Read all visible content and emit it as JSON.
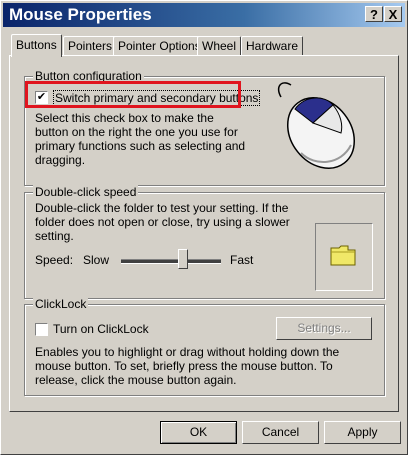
{
  "window": {
    "title": "Mouse Properties",
    "help_button": "?",
    "close_button": "X"
  },
  "tabs": [
    {
      "label": "Buttons",
      "active": true
    },
    {
      "label": "Pointers",
      "active": false
    },
    {
      "label": "Pointer Options",
      "active": false
    },
    {
      "label": "Wheel",
      "active": false
    },
    {
      "label": "Hardware",
      "active": false
    }
  ],
  "button_configuration": {
    "label": "Button configuration",
    "checkbox_label": "Switch primary and secondary buttons",
    "checked": true,
    "description": "Select this check box to make the button on the right the one you use for primary functions such as selecting and dragging.",
    "highlight_color": "#e0141e",
    "image": "mouse-icon"
  },
  "double_click_speed": {
    "label": "Double-click speed",
    "description": "Double-click the folder to test your setting. If the folder does not open or close, try using a slower setting.",
    "speed_label": "Speed:",
    "slow_label": "Slow",
    "fast_label": "Fast",
    "slider_value_fraction": 0.62,
    "test_area_icon": "folder-icon"
  },
  "clicklock": {
    "label": "ClickLock",
    "checkbox_label": "Turn on ClickLock",
    "checked": false,
    "settings_button": "Settings...",
    "description": "Enables you to highlight or drag without holding down the mouse button. To set, briefly press the mouse button. To release, click the mouse button again."
  },
  "footer": {
    "ok": "OK",
    "cancel": "Cancel",
    "apply": "Apply"
  }
}
